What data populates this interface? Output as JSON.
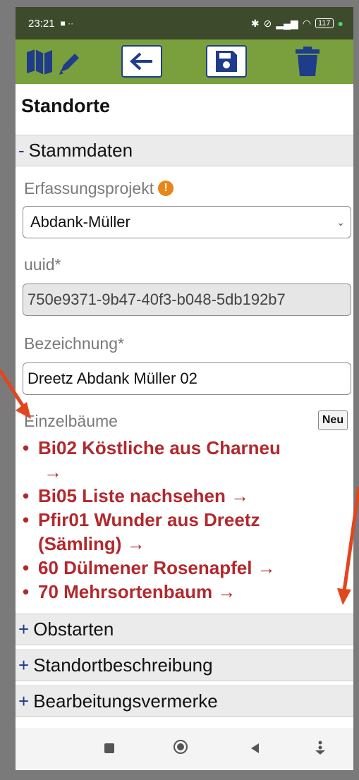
{
  "status_bar": {
    "time": "23:21",
    "notif_glyph": "■ ··",
    "battery": "117",
    "icons": [
      "bluetooth-icon",
      "mute-icon",
      "signal-icon",
      "wifi-icon",
      "battery-icon"
    ]
  },
  "toolbar": {
    "buttons": [
      "map-edit-icon",
      "back-arrow-icon",
      "save-icon",
      "trash-icon"
    ],
    "accent_color": "#7aa03d",
    "icon_color": "#1f3c8a"
  },
  "page": {
    "title": "Standorte"
  },
  "stammdaten": {
    "sign": "-",
    "label": "Stammdaten",
    "erfassungsprojekt_label": "Erfassungsprojekt",
    "erfassungsprojekt_value": "Abdank-Müller",
    "uuid_label": "uuid*",
    "uuid_value": "750e9371-9b47-40f3-b048-5db192b7",
    "bezeichnung_label": "Bezeichnung*",
    "bezeichnung_value": "Dreetz Abdank Müller 02",
    "einzelbaeume_label": "Einzelbäume",
    "neu_label": "Neu",
    "trees": [
      {
        "line1": "Bi02 Köstliche aus Charneu",
        "line2": "→"
      },
      {
        "line1": "Bi05 Liste nachsehen →",
        "line2": ""
      },
      {
        "line1": "Pfir01 Wunder aus Dreetz",
        "line2": "(Sämling) →"
      },
      {
        "line1": "60 Dülmener Rosenapfel →",
        "line2": ""
      },
      {
        "line1": "70 Mehrsortenbaum →",
        "line2": ""
      }
    ]
  },
  "sections": [
    {
      "sign": "+",
      "label": "Obstarten"
    },
    {
      "sign": "+",
      "label": "Standortbeschreibung"
    },
    {
      "sign": "+",
      "label": "Bearbeitungsvermerke"
    }
  ],
  "nav_bar": {
    "buttons": [
      "recents-icon",
      "home-icon",
      "back-icon",
      "keyboard-hide-icon"
    ]
  },
  "annotation_color": "#e2461e"
}
